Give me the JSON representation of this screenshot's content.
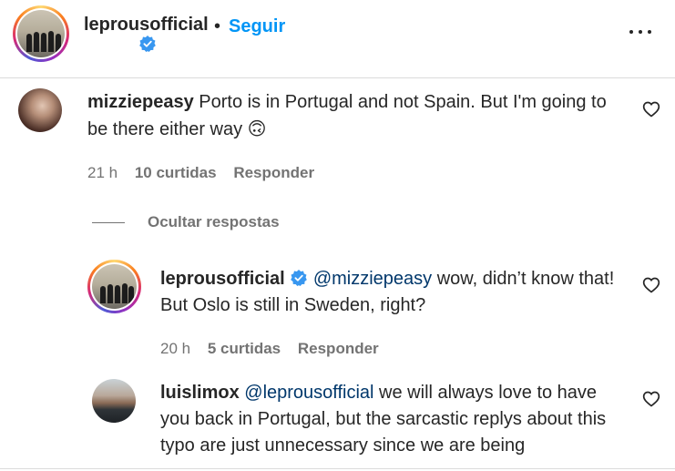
{
  "header": {
    "username": "leprousofficial",
    "separator": "•",
    "follow_label": "Seguir",
    "more_icon": "more-horizontal-icon"
  },
  "comments": [
    {
      "username": "mizziepeasy",
      "text": "Porto is in Portugal and not Spain. But I'm going to be there either way",
      "emoji": "🙃",
      "time": "21 h",
      "likes": "10 curtidas",
      "reply_label": "Responder"
    }
  ],
  "hide_replies_label": "Ocultar respostas",
  "replies": [
    {
      "username": "leprousofficial",
      "verified": true,
      "mention": "@mizziepeasy",
      "text": " wow, didn’t know that! But Oslo is still in Sweden, right?",
      "time": "20 h",
      "likes": "5 curtidas",
      "reply_label": "Responder"
    },
    {
      "username": "luislimox",
      "mention": "@leprousofficial",
      "text": " we will always love to have you back in Portugal, but the sarcastic replys about this typo are just unnecessary since we are being"
    }
  ],
  "colors": {
    "accent": "#0095f6",
    "verified": "#3897f0",
    "mention": "#00376b",
    "muted": "#737373"
  }
}
